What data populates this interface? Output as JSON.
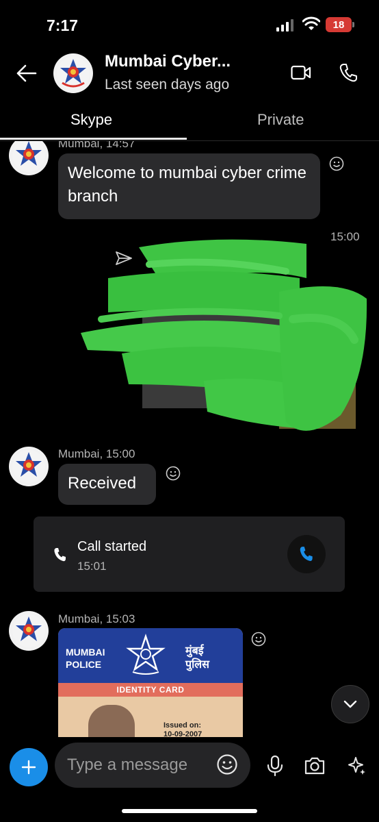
{
  "status_bar": {
    "time": "7:17",
    "battery_level": "18",
    "battery_color": "#d63a34",
    "signal_icon": "cellular-signal-icon",
    "wifi_icon": "wifi-icon"
  },
  "header": {
    "contact_name": "Mumbai Cyber...",
    "contact_status": "Last seen days ago",
    "back_icon": "arrow-left-icon",
    "video_icon": "video-camera-icon",
    "call_icon": "phone-icon"
  },
  "tabs": [
    {
      "label": "Skype",
      "active": true
    },
    {
      "label": "Private",
      "active": false
    }
  ],
  "messages": [
    {
      "type": "text",
      "sender_meta": "Mumbai, 14:57",
      "text": "Welcome to mumbai cyber crime branch"
    },
    {
      "type": "image-sent",
      "timestamp": "15:00"
    },
    {
      "type": "text",
      "sender_meta": "Mumbai, 15:00",
      "text": "Received"
    },
    {
      "type": "call",
      "title": "Call started",
      "time": "15:01"
    },
    {
      "type": "image",
      "sender_meta": "Mumbai, 15:03",
      "card": {
        "left_text": [
          "MUMBAI",
          "POLICE"
        ],
        "right_text": [
          "मुंबई",
          "पुलिस"
        ],
        "band": "IDENTITY CARD",
        "issued_label": "Issued on:",
        "issued_date": "10-09-2007"
      }
    }
  ],
  "composer": {
    "placeholder": "Type a message",
    "accent_color": "#1a8ee8"
  }
}
